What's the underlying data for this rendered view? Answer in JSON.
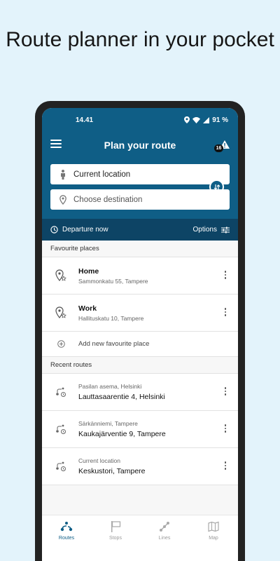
{
  "promo": {
    "title": "Route planner in your pocket"
  },
  "status_bar": {
    "time": "14.41",
    "battery": "91 %"
  },
  "header": {
    "title": "Plan your route",
    "alerts_count": "16"
  },
  "search": {
    "origin": "Current location",
    "destination_placeholder": "Choose destination"
  },
  "departure": {
    "label": "Departure now",
    "options_label": "Options"
  },
  "favourites": {
    "section_label": "Favourite places",
    "items": [
      {
        "name": "Home",
        "address": "Sammonkatu 55, Tampere"
      },
      {
        "name": "Work",
        "address": "Hallituskatu 10, Tampere"
      }
    ],
    "add_label": "Add new favourite place"
  },
  "recent": {
    "section_label": "Recent routes",
    "items": [
      {
        "from": "Pasilan asema, Helsinki",
        "to": "Lauttasaarentie 4, Helsinki"
      },
      {
        "from": "Särkänniemi, Tampere",
        "to": "Kaukajärventie 9, Tampere"
      },
      {
        "from": "Current location",
        "to": "Keskustori, Tampere"
      }
    ]
  },
  "nav": {
    "tabs": [
      {
        "label": "Routes",
        "icon": "routes-icon",
        "active": true
      },
      {
        "label": "Stops",
        "icon": "stop-flag-icon",
        "active": false
      },
      {
        "label": "Lines",
        "icon": "lines-icon",
        "active": false
      },
      {
        "label": "Map",
        "icon": "map-icon",
        "active": false
      }
    ]
  },
  "colors": {
    "primary": "#0f5e86",
    "primary_dark": "#0d4465",
    "background": "#e3f3fb"
  }
}
